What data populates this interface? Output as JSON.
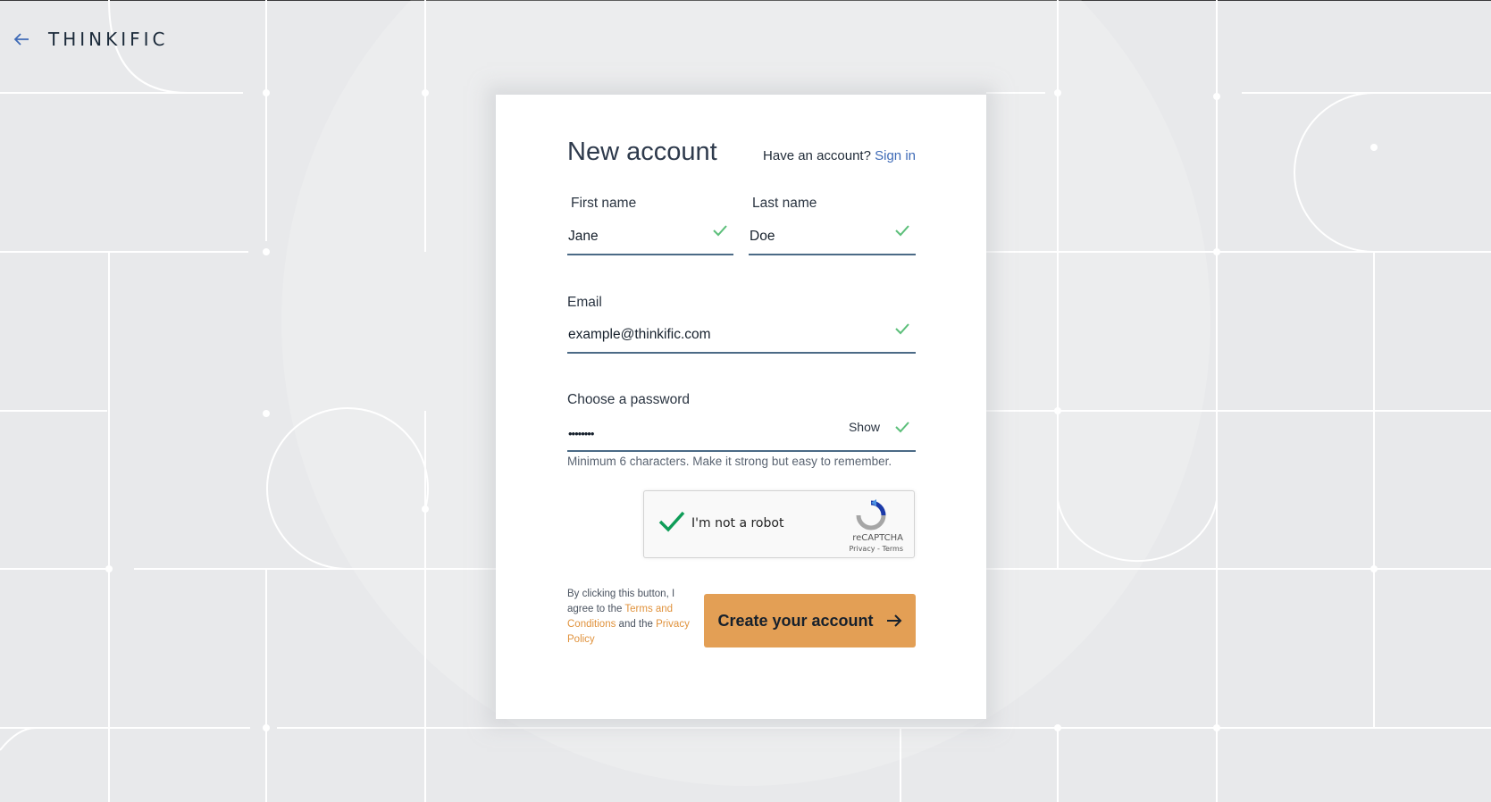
{
  "header": {
    "logo_text": "THINKIFIC"
  },
  "form": {
    "title": "New account",
    "have_account_text": "Have an account?",
    "signin_link": "Sign in",
    "first_name": {
      "label": "First name",
      "value": "Jane"
    },
    "last_name": {
      "label": "Last name",
      "value": "Doe"
    },
    "email": {
      "label": "Email",
      "value": "example@thinkific.com"
    },
    "password": {
      "label": "Choose a password",
      "value": "••••••••",
      "show_label": "Show"
    },
    "password_hint": "Minimum 6 characters. Make it strong but easy to remember.",
    "captcha": {
      "label": "I'm not a robot",
      "brand": "reCAPTCHA",
      "links": "Privacy - Terms"
    },
    "legal": {
      "prefix": "By clicking this button, I agree to the",
      "terms_link": "Terms and Conditions",
      "middle": "and the",
      "privacy_link": "Privacy Policy"
    },
    "submit_label": "Create your account"
  },
  "colors": {
    "accent_button": "#e39f55",
    "link_blue": "#3f6bb7",
    "link_orange": "#e0923c",
    "check_green": "#5cbf7a",
    "background": "#e8e9eb"
  },
  "icons": {
    "back": "arrow-left-icon",
    "valid": "checkmark-icon",
    "submit": "arrow-right-icon",
    "captcha": "recaptcha-logo-icon"
  }
}
